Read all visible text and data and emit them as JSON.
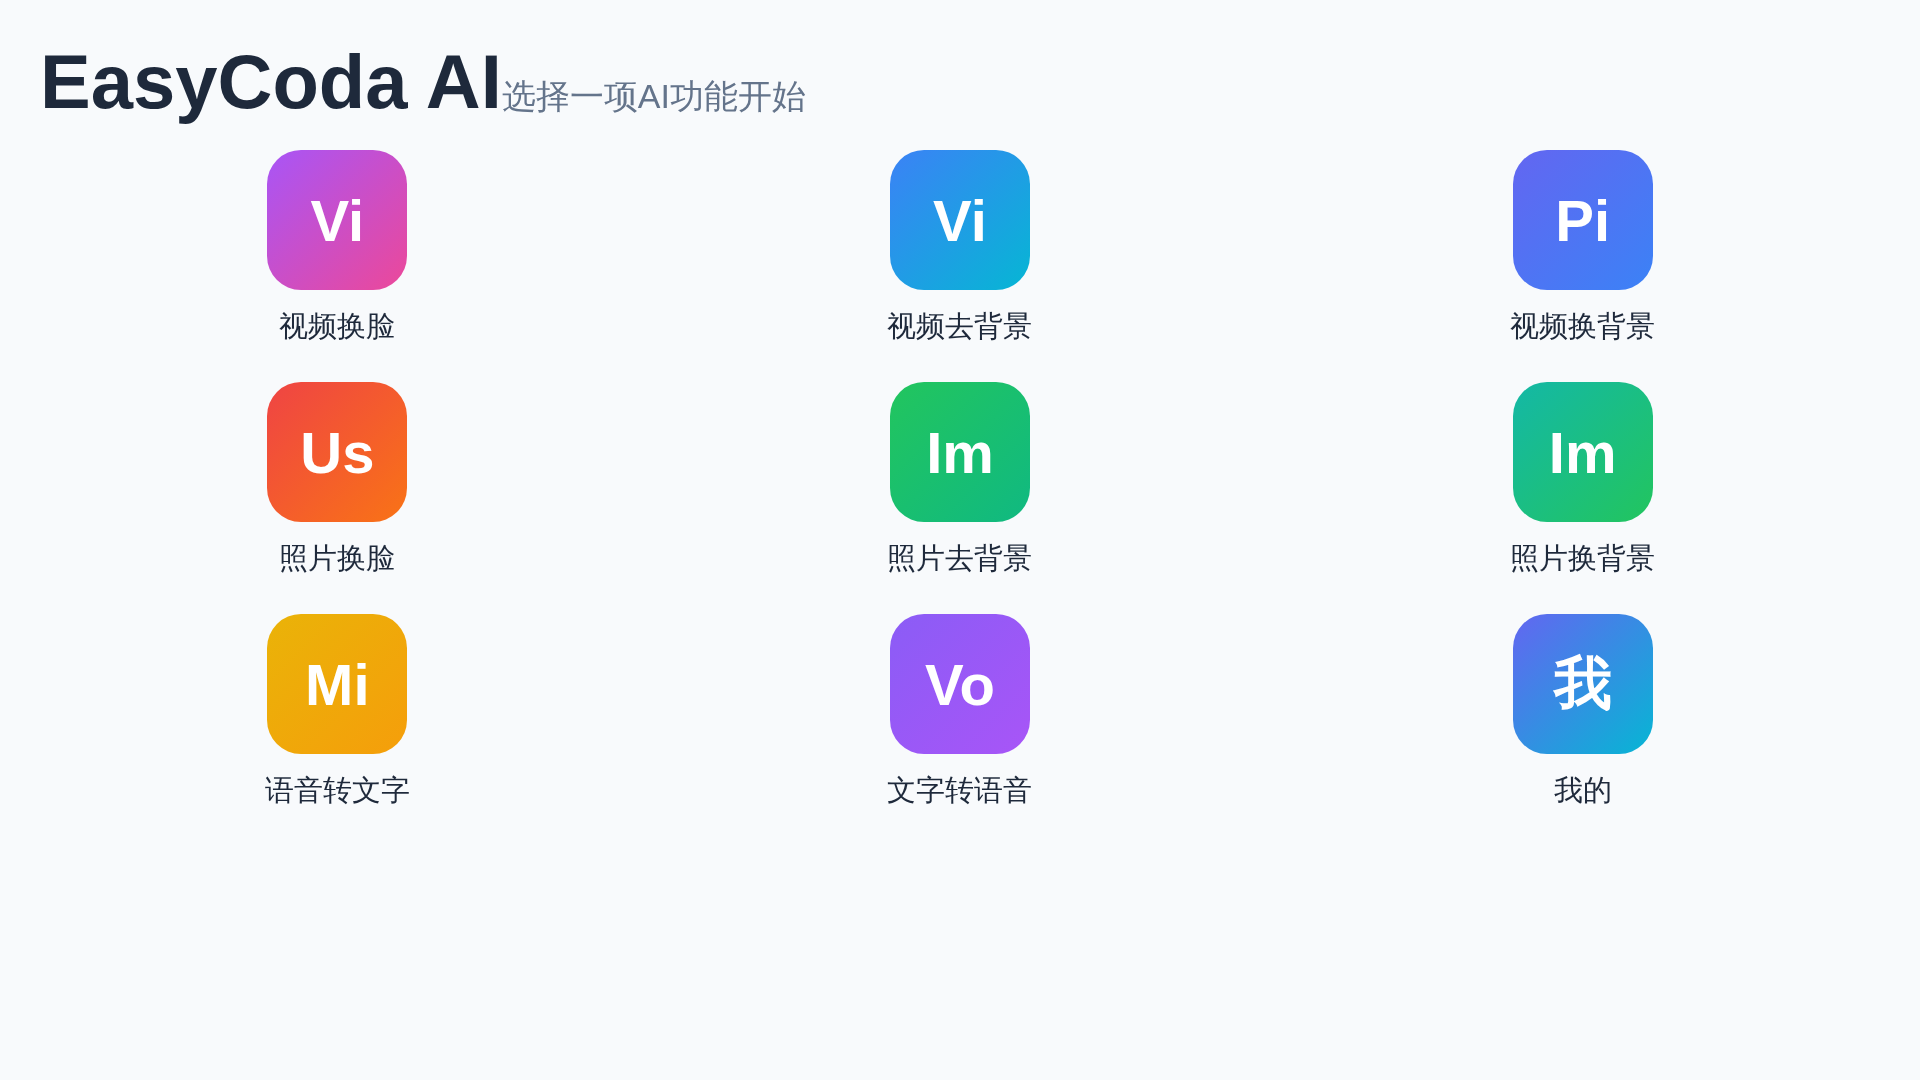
{
  "header": {
    "title": "EasyCoda AI",
    "subtitle": "选择一项AI功能开始"
  },
  "features": [
    {
      "badge": "Vi",
      "label": "视频换脸",
      "gradient": [
        {
          "color": "#a855f7"
        },
        {
          "color": "#ec4899"
        }
      ]
    },
    {
      "badge": "Vi",
      "label": "视频去背景",
      "gradient": [
        {
          "color": "#3b82f6"
        },
        {
          "color": "#06b6d4"
        }
      ]
    },
    {
      "badge": "Pi",
      "label": "视频换背景",
      "gradient": [
        {
          "color": "#6366f1"
        },
        {
          "color": "#3b82f6"
        }
      ]
    },
    {
      "badge": "Us",
      "label": "照片换脸",
      "gradient": [
        {
          "color": "#ef4444"
        },
        {
          "color": "#f97316"
        }
      ]
    },
    {
      "badge": "Im",
      "label": "照片去背景",
      "gradient": [
        {
          "color": "#22c55e"
        },
        {
          "color": "#10b981"
        }
      ]
    },
    {
      "badge": "Im",
      "label": "照片换背景",
      "gradient": [
        {
          "color": "#14b8a6"
        },
        {
          "color": "#22c55e"
        }
      ]
    },
    {
      "badge": "Mi",
      "label": "语音转文字",
      "gradient": [
        {
          "color": "#eab308"
        },
        {
          "color": "#f59e0b"
        }
      ]
    },
    {
      "badge": "Vo",
      "label": "文字转语音",
      "gradient": [
        {
          "color": "#8b5cf6"
        },
        {
          "color": "#a855f7"
        }
      ]
    },
    {
      "badge": "我",
      "label": "我的",
      "gradient": [
        {
          "color": "#6366f1"
        },
        {
          "color": "#06b6d4"
        }
      ]
    }
  ]
}
